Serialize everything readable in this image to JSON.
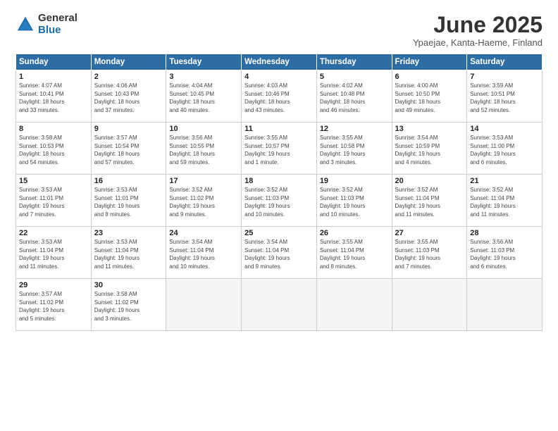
{
  "logo": {
    "general": "General",
    "blue": "Blue"
  },
  "title": "June 2025",
  "subtitle": "Ypaejae, Kanta-Haeme, Finland",
  "days_header": [
    "Sunday",
    "Monday",
    "Tuesday",
    "Wednesday",
    "Thursday",
    "Friday",
    "Saturday"
  ],
  "weeks": [
    [
      {
        "day": "1",
        "info": "Sunrise: 4:07 AM\nSunset: 10:41 PM\nDaylight: 18 hours\nand 33 minutes."
      },
      {
        "day": "2",
        "info": "Sunrise: 4:06 AM\nSunset: 10:43 PM\nDaylight: 18 hours\nand 37 minutes."
      },
      {
        "day": "3",
        "info": "Sunrise: 4:04 AM\nSunset: 10:45 PM\nDaylight: 18 hours\nand 40 minutes."
      },
      {
        "day": "4",
        "info": "Sunrise: 4:03 AM\nSunset: 10:46 PM\nDaylight: 18 hours\nand 43 minutes."
      },
      {
        "day": "5",
        "info": "Sunrise: 4:02 AM\nSunset: 10:48 PM\nDaylight: 18 hours\nand 46 minutes."
      },
      {
        "day": "6",
        "info": "Sunrise: 4:00 AM\nSunset: 10:50 PM\nDaylight: 18 hours\nand 49 minutes."
      },
      {
        "day": "7",
        "info": "Sunrise: 3:59 AM\nSunset: 10:51 PM\nDaylight: 18 hours\nand 52 minutes."
      }
    ],
    [
      {
        "day": "8",
        "info": "Sunrise: 3:58 AM\nSunset: 10:53 PM\nDaylight: 18 hours\nand 54 minutes."
      },
      {
        "day": "9",
        "info": "Sunrise: 3:57 AM\nSunset: 10:54 PM\nDaylight: 18 hours\nand 57 minutes."
      },
      {
        "day": "10",
        "info": "Sunrise: 3:56 AM\nSunset: 10:55 PM\nDaylight: 18 hours\nand 59 minutes."
      },
      {
        "day": "11",
        "info": "Sunrise: 3:55 AM\nSunset: 10:57 PM\nDaylight: 19 hours\nand 1 minute."
      },
      {
        "day": "12",
        "info": "Sunrise: 3:55 AM\nSunset: 10:58 PM\nDaylight: 19 hours\nand 3 minutes."
      },
      {
        "day": "13",
        "info": "Sunrise: 3:54 AM\nSunset: 10:59 PM\nDaylight: 19 hours\nand 4 minutes."
      },
      {
        "day": "14",
        "info": "Sunrise: 3:53 AM\nSunset: 11:00 PM\nDaylight: 19 hours\nand 6 minutes."
      }
    ],
    [
      {
        "day": "15",
        "info": "Sunrise: 3:53 AM\nSunset: 11:01 PM\nDaylight: 19 hours\nand 7 minutes."
      },
      {
        "day": "16",
        "info": "Sunrise: 3:53 AM\nSunset: 11:01 PM\nDaylight: 19 hours\nand 8 minutes."
      },
      {
        "day": "17",
        "info": "Sunrise: 3:52 AM\nSunset: 11:02 PM\nDaylight: 19 hours\nand 9 minutes."
      },
      {
        "day": "18",
        "info": "Sunrise: 3:52 AM\nSunset: 11:03 PM\nDaylight: 19 hours\nand 10 minutes."
      },
      {
        "day": "19",
        "info": "Sunrise: 3:52 AM\nSunset: 11:03 PM\nDaylight: 19 hours\nand 10 minutes."
      },
      {
        "day": "20",
        "info": "Sunrise: 3:52 AM\nSunset: 11:04 PM\nDaylight: 19 hours\nand 11 minutes."
      },
      {
        "day": "21",
        "info": "Sunrise: 3:52 AM\nSunset: 11:04 PM\nDaylight: 19 hours\nand 11 minutes."
      }
    ],
    [
      {
        "day": "22",
        "info": "Sunrise: 3:53 AM\nSunset: 11:04 PM\nDaylight: 19 hours\nand 11 minutes."
      },
      {
        "day": "23",
        "info": "Sunrise: 3:53 AM\nSunset: 11:04 PM\nDaylight: 19 hours\nand 11 minutes."
      },
      {
        "day": "24",
        "info": "Sunrise: 3:54 AM\nSunset: 11:04 PM\nDaylight: 19 hours\nand 10 minutes."
      },
      {
        "day": "25",
        "info": "Sunrise: 3:54 AM\nSunset: 11:04 PM\nDaylight: 19 hours\nand 9 minutes."
      },
      {
        "day": "26",
        "info": "Sunrise: 3:55 AM\nSunset: 11:04 PM\nDaylight: 19 hours\nand 8 minutes."
      },
      {
        "day": "27",
        "info": "Sunrise: 3:55 AM\nSunset: 11:03 PM\nDaylight: 19 hours\nand 7 minutes."
      },
      {
        "day": "28",
        "info": "Sunrise: 3:56 AM\nSunset: 11:03 PM\nDaylight: 19 hours\nand 6 minutes."
      }
    ],
    [
      {
        "day": "29",
        "info": "Sunrise: 3:57 AM\nSunset: 11:02 PM\nDaylight: 19 hours\nand 5 minutes."
      },
      {
        "day": "30",
        "info": "Sunrise: 3:58 AM\nSunset: 11:02 PM\nDaylight: 19 hours\nand 3 minutes."
      },
      {
        "day": "",
        "info": ""
      },
      {
        "day": "",
        "info": ""
      },
      {
        "day": "",
        "info": ""
      },
      {
        "day": "",
        "info": ""
      },
      {
        "day": "",
        "info": ""
      }
    ]
  ]
}
